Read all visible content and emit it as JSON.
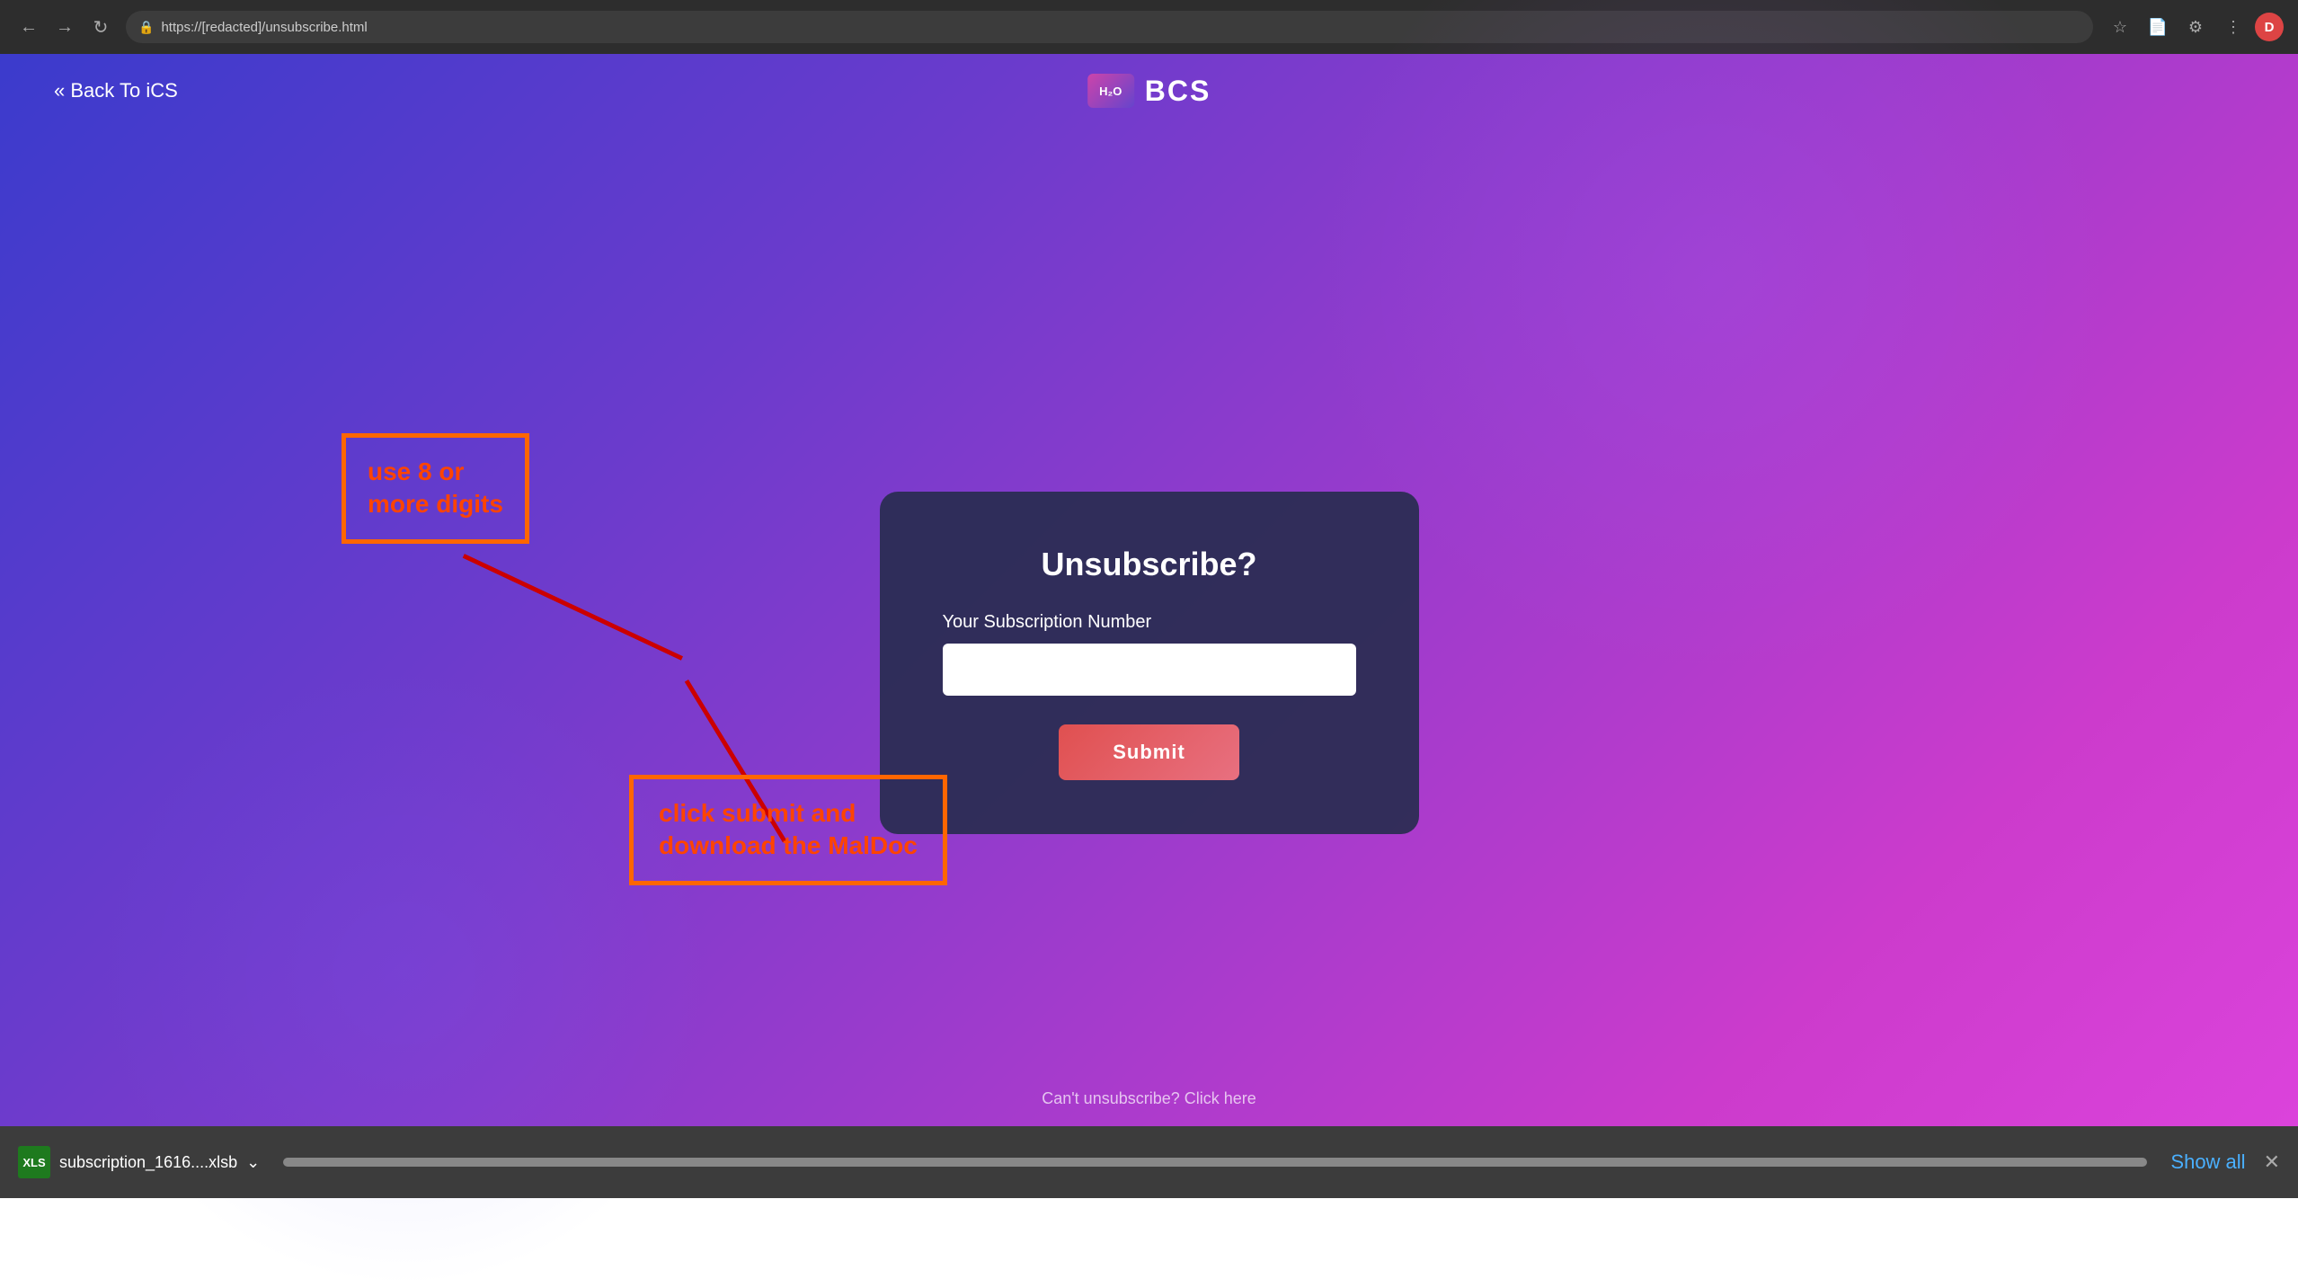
{
  "browser": {
    "url": "https://[redacted]/unsubscribe.html",
    "profile_initial": "D"
  },
  "nav": {
    "back_label": "« Back To iCS",
    "logo_icon_text": "H₂O",
    "logo_text": "BCS"
  },
  "card": {
    "title": "Unsubscribe?",
    "label": "Your Subscription Number",
    "input_placeholder": "",
    "submit_label": "Submit"
  },
  "annotations": {
    "box1_text": "use 8 or\nmore digits",
    "box2_text": "click submit and\ndownload the MalDoc"
  },
  "footer": {
    "cant_text": "Can't unsubscribe? Click here"
  },
  "download_bar": {
    "file_name": "subscription_1616....xlsb",
    "show_all_label": "Show all"
  }
}
